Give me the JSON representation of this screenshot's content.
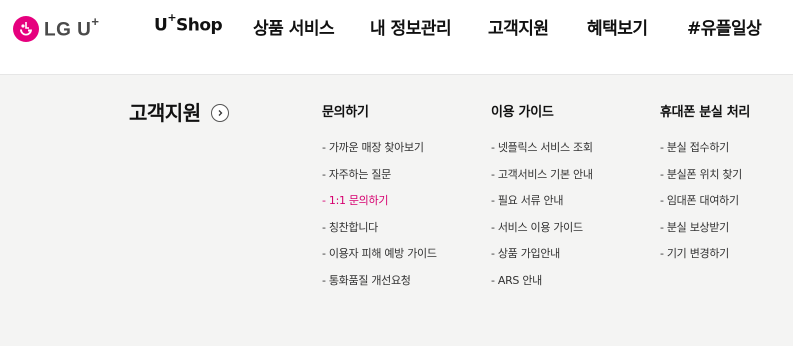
{
  "brand": {
    "logo_text": "LG U",
    "logo_plus": "+",
    "accent_color": "#e6007e",
    "icon": "lg-face-icon"
  },
  "gnb": [
    {
      "pre": "U",
      "sup": "+",
      "post": "Shop"
    },
    {
      "pre": "상품 서비스",
      "sup": "",
      "post": ""
    },
    {
      "pre": "내 정보관리",
      "sup": "",
      "post": ""
    },
    {
      "pre": "고객지원",
      "sup": "",
      "post": ""
    },
    {
      "pre": "혜택보기",
      "sup": "",
      "post": ""
    },
    {
      "pre": "#유플일상",
      "sup": "",
      "post": ""
    }
  ],
  "panel": {
    "title": "고객지원",
    "title_icon": "chevron-right-circle-icon",
    "columns": [
      {
        "title": "문의하기",
        "items": [
          {
            "label": "- 가까운 매장 찾아보기",
            "active": false
          },
          {
            "label": "- 자주하는 질문",
            "active": false
          },
          {
            "label": "- 1:1 문의하기",
            "active": true
          },
          {
            "label": "- 칭찬합니다",
            "active": false
          },
          {
            "label": "- 이용자 피해 예방 가이드",
            "active": false
          },
          {
            "label": "- 통화품질 개선요청",
            "active": false
          }
        ]
      },
      {
        "title": "이용 가이드",
        "items": [
          {
            "label": "- 넷플릭스 서비스 조회",
            "active": false
          },
          {
            "label": "- 고객서비스 기본 안내",
            "active": false
          },
          {
            "label": "- 필요 서류 안내",
            "active": false
          },
          {
            "label": "- 서비스 이용 가이드",
            "active": false
          },
          {
            "label": "- 상품 가입안내",
            "active": false
          },
          {
            "label": "- ARS 안내",
            "active": false
          }
        ]
      },
      {
        "title": "휴대폰 분실 처리",
        "items": [
          {
            "label": "- 분실 접수하기",
            "active": false
          },
          {
            "label": "- 분실폰 위치 찾기",
            "active": false
          },
          {
            "label": "- 임대폰 대여하기",
            "active": false
          },
          {
            "label": "- 분실 보상받기",
            "active": false
          },
          {
            "label": "- 기기 변경하기",
            "active": false
          }
        ]
      }
    ],
    "active_color": "#d6006f"
  }
}
